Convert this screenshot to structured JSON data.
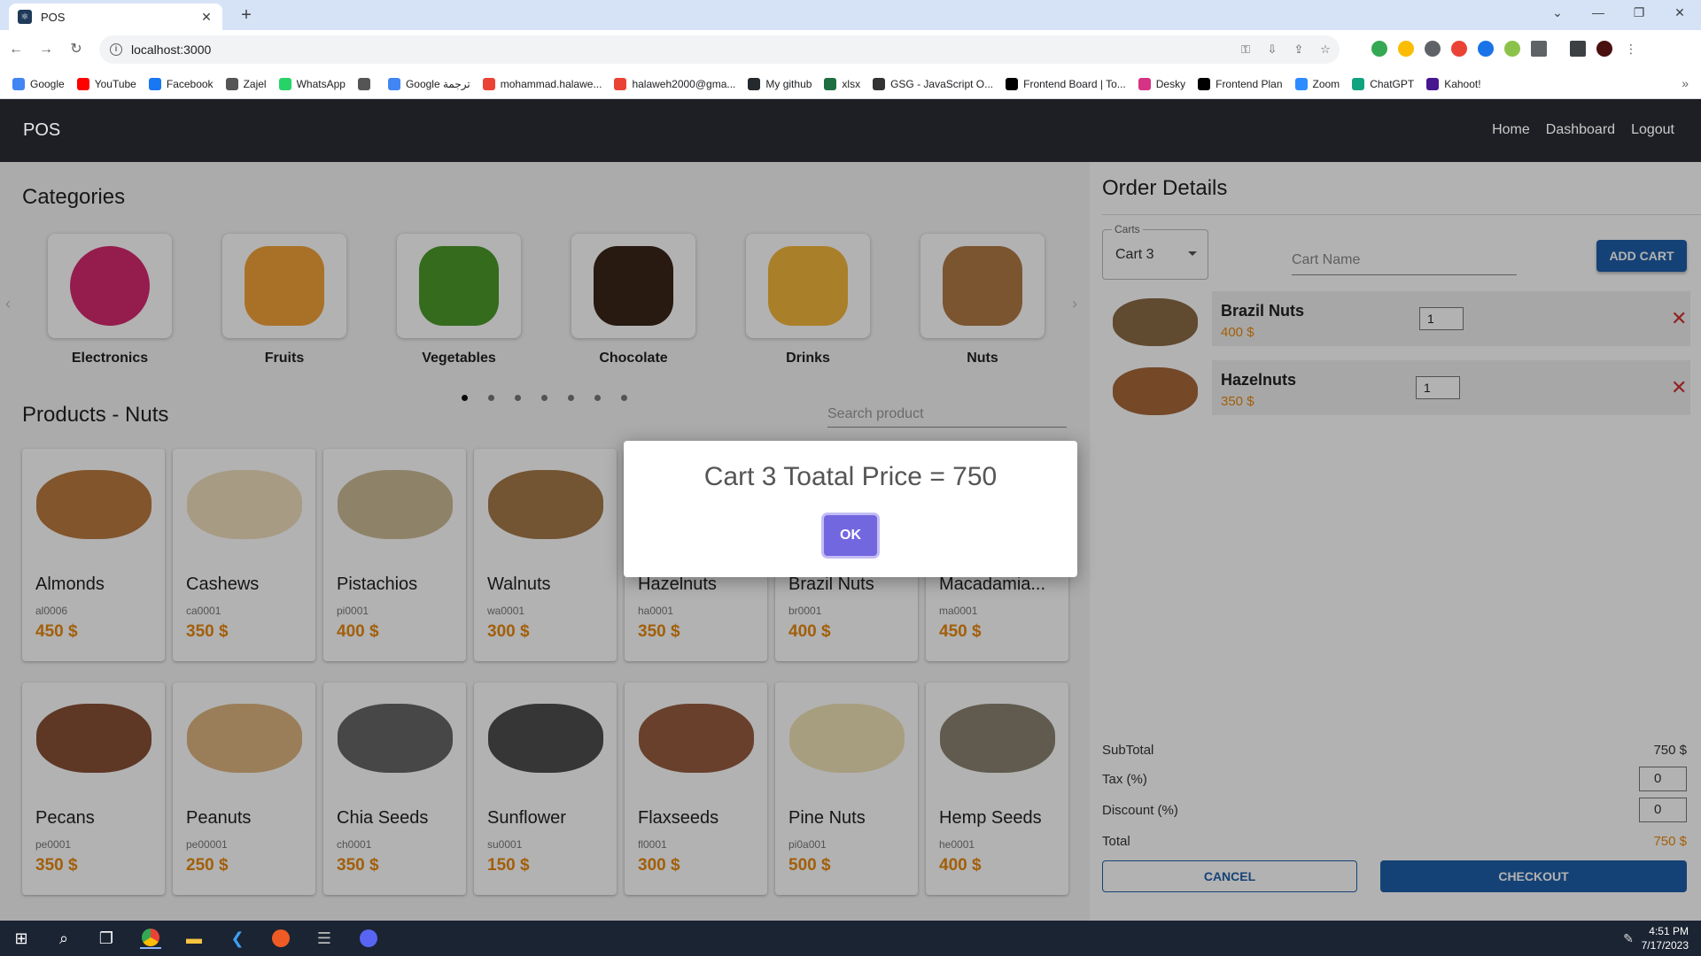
{
  "browser": {
    "tab_title": "POS",
    "url": "localhost:3000",
    "bookmarks": [
      {
        "label": "Google",
        "color": "#4285f4"
      },
      {
        "label": "YouTube",
        "color": "#ff0000"
      },
      {
        "label": "Facebook",
        "color": "#1877f2"
      },
      {
        "label": "Zajel",
        "color": "#555555"
      },
      {
        "label": "WhatsApp",
        "color": "#25d366"
      },
      {
        "label": "",
        "color": "#555555"
      },
      {
        "label": "Google ترجمة",
        "color": "#4285f4"
      },
      {
        "label": "mohammad.halawe...",
        "color": "#ea4335"
      },
      {
        "label": "halaweh2000@gma...",
        "color": "#ea4335"
      },
      {
        "label": "My github",
        "color": "#24292e"
      },
      {
        "label": "xlsx",
        "color": "#1d6f42"
      },
      {
        "label": "GSG - JavaScript O...",
        "color": "#333333"
      },
      {
        "label": "Frontend Board | To...",
        "color": "#000000"
      },
      {
        "label": "Desky",
        "color": "#d63384"
      },
      {
        "label": "Frontend Plan",
        "color": "#000000"
      },
      {
        "label": "Zoom",
        "color": "#2d8cff"
      },
      {
        "label": "ChatGPT",
        "color": "#10a37f"
      },
      {
        "label": "Kahoot!",
        "color": "#46178f"
      }
    ]
  },
  "header": {
    "brand": "POS",
    "nav": [
      "Home",
      "Dashboard",
      "Logout"
    ]
  },
  "categories": {
    "title": "Categories",
    "items": [
      {
        "label": "Electronics",
        "icon": "electronics-icon"
      },
      {
        "label": "Fruits",
        "icon": "fruits-icon"
      },
      {
        "label": "Vegetables",
        "icon": "vegetables-icon"
      },
      {
        "label": "Chocolate",
        "icon": "chocolate-icon"
      },
      {
        "label": "Drinks",
        "icon": "drinks-icon"
      },
      {
        "label": "Nuts",
        "icon": "nuts-icon"
      }
    ],
    "dots": 7,
    "active_dot": 0
  },
  "products": {
    "title": "Products - Nuts",
    "search_placeholder": "Search product",
    "items": [
      {
        "name": "Almonds",
        "sku": "al0006",
        "price": "450 $",
        "color": "#b36b2a"
      },
      {
        "name": "Cashews",
        "sku": "ca0001",
        "price": "350 $",
        "color": "#eedcb6"
      },
      {
        "name": "Pistachios",
        "sku": "pi0001",
        "price": "400 $",
        "color": "#c7b48a"
      },
      {
        "name": "Walnuts",
        "sku": "wa0001",
        "price": "300 $",
        "color": "#9b6a35"
      },
      {
        "name": "Hazelnuts",
        "sku": "ha0001",
        "price": "350 $",
        "color": "#a8683a"
      },
      {
        "name": "Brazil Nuts",
        "sku": "br0001",
        "price": "400 $",
        "color": "#8a6a45"
      },
      {
        "name": "Macadamia...",
        "sku": "ma0001",
        "price": "450 $",
        "color": "#e2c99a"
      },
      {
        "name": "Pecans",
        "sku": "pe0001",
        "price": "350 $",
        "color": "#7a3c1f"
      },
      {
        "name": "Peanuts",
        "sku": "pe00001",
        "price": "250 $",
        "color": "#d9ad72"
      },
      {
        "name": "Chia Seeds",
        "sku": "ch0001",
        "price": "350 $",
        "color": "#555555"
      },
      {
        "name": "Sunflower",
        "sku": "su0001",
        "price": "150 $",
        "color": "#3b3b3b"
      },
      {
        "name": "Flaxseeds",
        "sku": "fl0001",
        "price": "300 $",
        "color": "#8b4a2a"
      },
      {
        "name": "Pine Nuts",
        "sku": "pi0a001",
        "price": "500 $",
        "color": "#eedfae"
      },
      {
        "name": "Hemp Seeds",
        "sku": "he0001",
        "price": "400 $",
        "color": "#7d7560"
      }
    ]
  },
  "order": {
    "title": "Order Details",
    "carts_label": "Carts",
    "selected_cart": "Cart 3",
    "cart_name_placeholder": "Cart Name",
    "add_cart_label": "ADD CART",
    "items": [
      {
        "name": "Brazil Nuts",
        "price": "400 $",
        "qty": "1",
        "color": "#8a6a45"
      },
      {
        "name": "Hazelnuts",
        "price": "350 $",
        "qty": "1",
        "color": "#a8683a"
      }
    ],
    "subtotal_label": "SubTotal",
    "subtotal_value": "750 $",
    "tax_label": "Tax (%)",
    "tax_value": "0",
    "discount_label": "Discount (%)",
    "discount_value": "0",
    "total_label": "Total",
    "total_value": "750 $",
    "cancel_label": "CANCEL",
    "checkout_label": "CHECKOUT"
  },
  "modal": {
    "title": "Cart 3 Toatal Price = 750",
    "ok_label": "OK"
  },
  "taskbar": {
    "time": "4:51 PM",
    "date": "7/17/2023"
  },
  "colors": {
    "accent": "#1f5fa9",
    "price": "#e8880f",
    "modal_button": "#7367e0"
  }
}
